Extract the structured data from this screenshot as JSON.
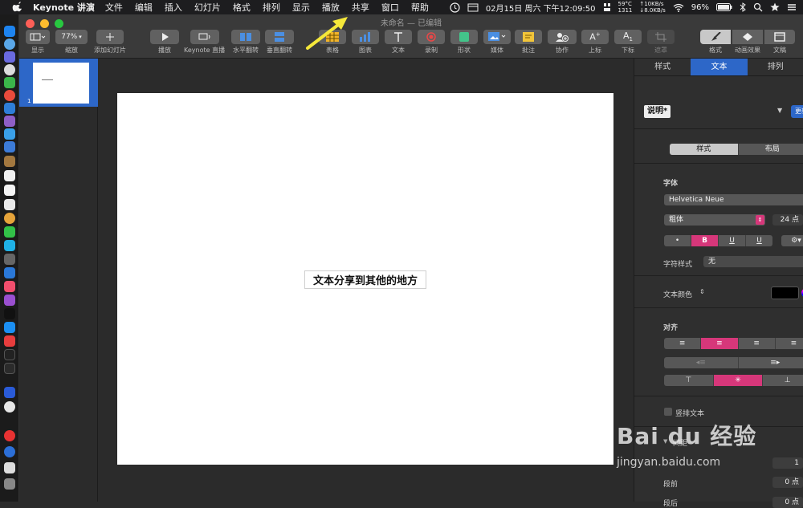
{
  "menubar": {
    "app_name": "Keynote 讲演",
    "menus": [
      "文件",
      "编辑",
      "插入",
      "幻灯片",
      "格式",
      "排列",
      "显示",
      "播放",
      "共享",
      "窗口",
      "帮助"
    ],
    "date_time": "02月15日 周六 下午12:09:50",
    "temperature": "59°C",
    "temp_sub": "1311",
    "net_up": "↑10KB/s",
    "net_down": "↓8.0KB/s",
    "battery": "96%"
  },
  "window": {
    "title": "未命名 — 已编辑"
  },
  "toolbar": {
    "view_label": "显示",
    "zoom_value": "77%",
    "zoom_label": "缩放",
    "add_slide_label": "添加幻灯片",
    "play_label": "播放",
    "keynote_live_label": "Keynote 直播",
    "flip_h_label": "水平翻转",
    "flip_v_label": "垂直翻转",
    "table_label": "表格",
    "chart_label": "图表",
    "text_label": "文本",
    "record_label": "录制",
    "shape_label": "形状",
    "media_label": "媒体",
    "comment_label": "批注",
    "collaborate_label": "协作",
    "superscript_label": "上标",
    "subscript_label": "下标",
    "mask_label": "遮罩",
    "format_label": "格式",
    "animate_label": "动画效果",
    "document_label": "文稿"
  },
  "navigator": {
    "slide_number": "1"
  },
  "slide": {
    "text": "文本分享到其他的地方"
  },
  "inspector": {
    "tabs": [
      "样式",
      "文本",
      "排列"
    ],
    "active_tab": "文本",
    "paragraph_style": "说明*",
    "update_label": "更新",
    "subtabs": [
      "样式",
      "布局"
    ],
    "font_heading": "字体",
    "font_name": "Helvetica Neue",
    "font_weight": "粗体",
    "font_size": "24 点",
    "char_buttons": [
      "•",
      "B",
      "U",
      "U"
    ],
    "char_style_label": "字符样式",
    "char_style_value": "无",
    "text_color_label": "文本颜色",
    "align_heading": "对齐",
    "vertical_text_label": "竖排文本",
    "spacing_heading": "间距",
    "line_spacing_value": "1",
    "before_label": "段前",
    "before_value": "0 点",
    "after_label": "段后",
    "after_value": "0 点"
  },
  "watermark": {
    "brand": "Bai du 经验",
    "url": "jingyan.baidu.com"
  },
  "colors": {
    "accent_blue": "#2d67c8",
    "accent_pink": "#d6377a",
    "arrow_yellow": "#f5e83a"
  }
}
